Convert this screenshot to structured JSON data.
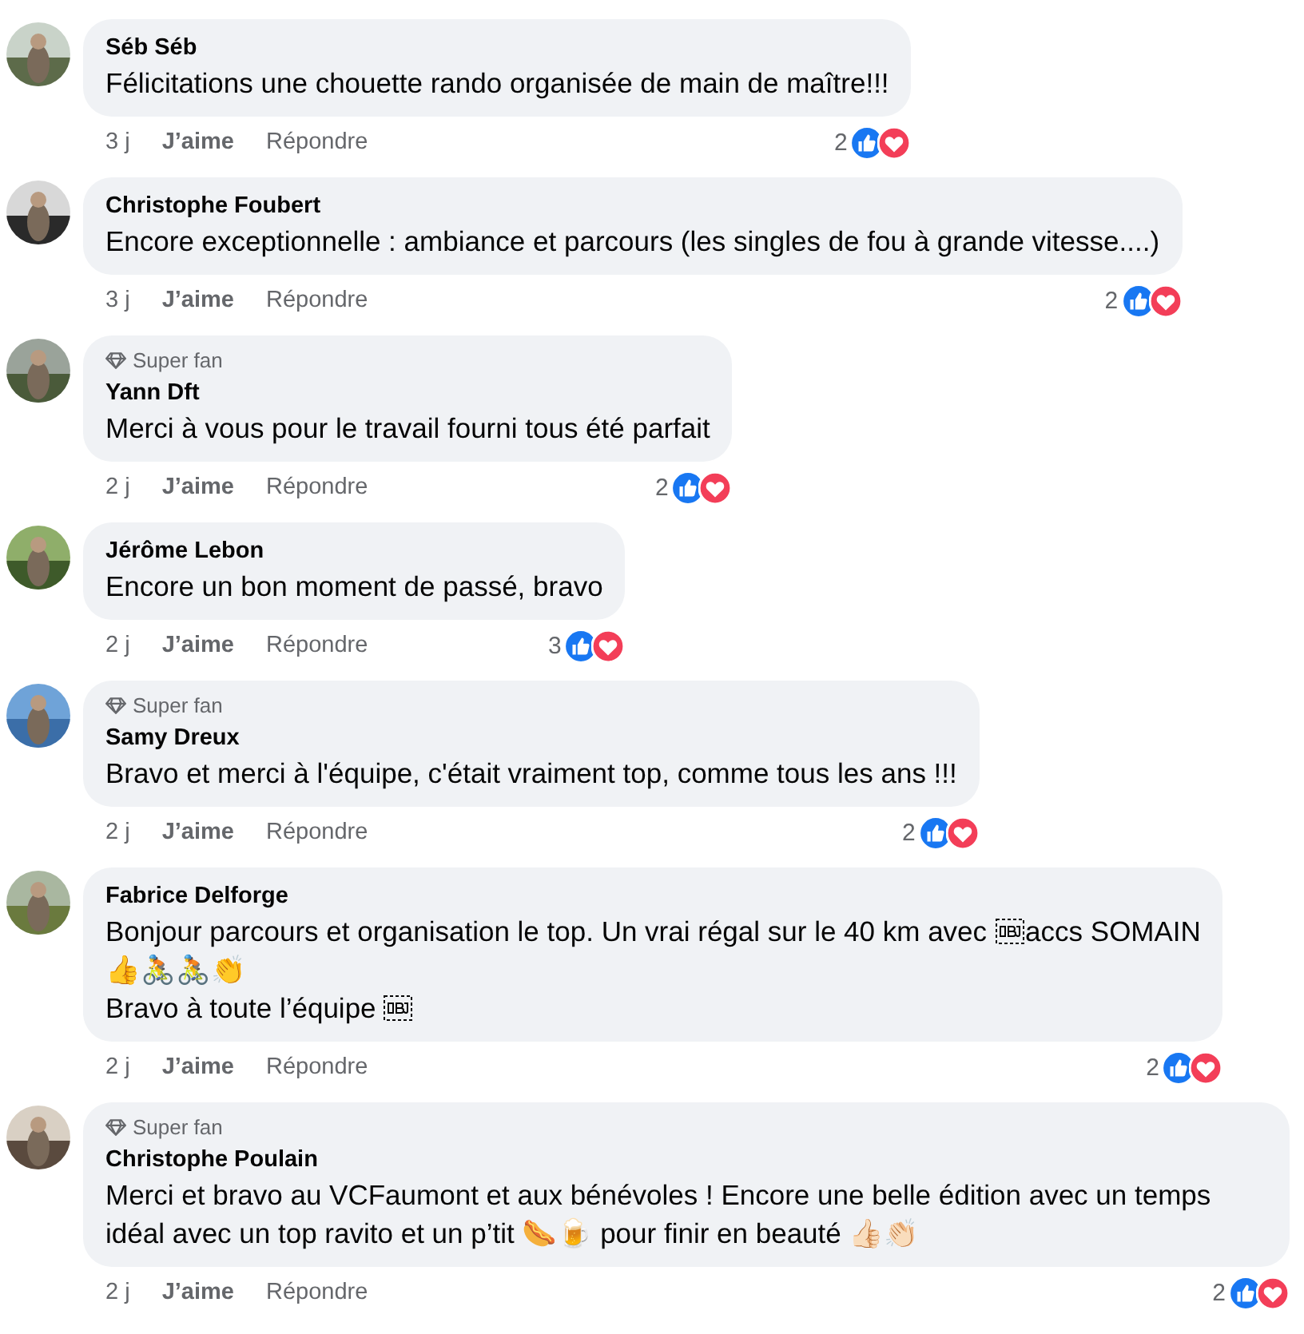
{
  "comments": [
    {
      "author": "Séb Séb",
      "text": [
        [
          {
            "kind": "text",
            "text": "Félicitations une chouette rando organisée de main de maître!!!"
          }
        ]
      ],
      "time": "3 j",
      "like": "J’aime",
      "reply": "Répondre",
      "reaction_count": "2",
      "super_fan": false,
      "avatar": {
        "kind": "picture"
      }
    },
    {
      "author": "Christophe Foubert",
      "text": [
        [
          {
            "kind": "text",
            "text": "Encore exceptionnelle : ambiance et parcours (les singles de fou à grande vitesse....)"
          }
        ]
      ],
      "time": "3 j",
      "like": "J’aime",
      "reply": "Répondre",
      "reaction_count": "2",
      "super_fan": false,
      "avatar": {
        "kind": "picture"
      }
    },
    {
      "author": "Yann Dft",
      "text": [
        [
          {
            "kind": "text",
            "text": "Merci à vous pour le travail fourni tous été parfait"
          }
        ]
      ],
      "time": "2 j",
      "like": "J’aime",
      "reply": "Répondre",
      "reaction_count": "2",
      "super_fan": true,
      "badge": "Super fan",
      "avatar": {
        "kind": "picture"
      }
    },
    {
      "author": "Jérôme Lebon",
      "text": [
        [
          {
            "kind": "text",
            "text": "Encore un bon moment de passé, bravo"
          }
        ]
      ],
      "time": "2 j",
      "like": "J’aime",
      "reply": "Répondre",
      "reaction_count": "3",
      "super_fan": false,
      "avatar": {
        "kind": "picture"
      }
    },
    {
      "author": "Samy Dreux",
      "text": [
        [
          {
            "kind": "text",
            "text": "Bravo et merci à l'équipe, c'était vraiment top, comme tous les ans !!!"
          }
        ]
      ],
      "time": "2 j",
      "like": "J’aime",
      "reply": "Répondre",
      "reaction_count": "2",
      "super_fan": true,
      "badge": "Super fan",
      "avatar": {
        "kind": "picture"
      }
    },
    {
      "author": "Fabrice Delforge",
      "text": [
        [
          {
            "kind": "text",
            "text": "Bonjour parcours et organisation le top. Un vrai régal sur le 40 km avec"
          },
          {
            "kind": "object-mark"
          },
          {
            "kind": "text",
            "text": "accs SOMAIN"
          }
        ],
        [
          {
            "kind": "text",
            "text": "👍🚴🚴👏"
          }
        ],
        [
          {
            "kind": "text",
            "text": "Bravo à toute l’équipe"
          },
          {
            "kind": "object-mark"
          }
        ]
      ],
      "time": "2 j",
      "like": "J’aime",
      "reply": "Répondre",
      "reaction_count": "2",
      "super_fan": false,
      "avatar": {
        "kind": "picture"
      }
    },
    {
      "author": "Christophe Poulain",
      "text": [
        [
          {
            "kind": "text",
            "text": "Merci et bravo au VCFaumont et aux bénévoles ! Encore une belle édition avec un temps idéal avec un top ravito et un p’tit 🌭🍺 pour finir en beauté 👍🏻👏🏻"
          }
        ]
      ],
      "time": "2 j",
      "like": "J’aime",
      "reply": "Répondre",
      "reaction_count": "2",
      "super_fan": true,
      "badge": "Super fan",
      "avatar": {
        "kind": "picture"
      }
    }
  ]
}
